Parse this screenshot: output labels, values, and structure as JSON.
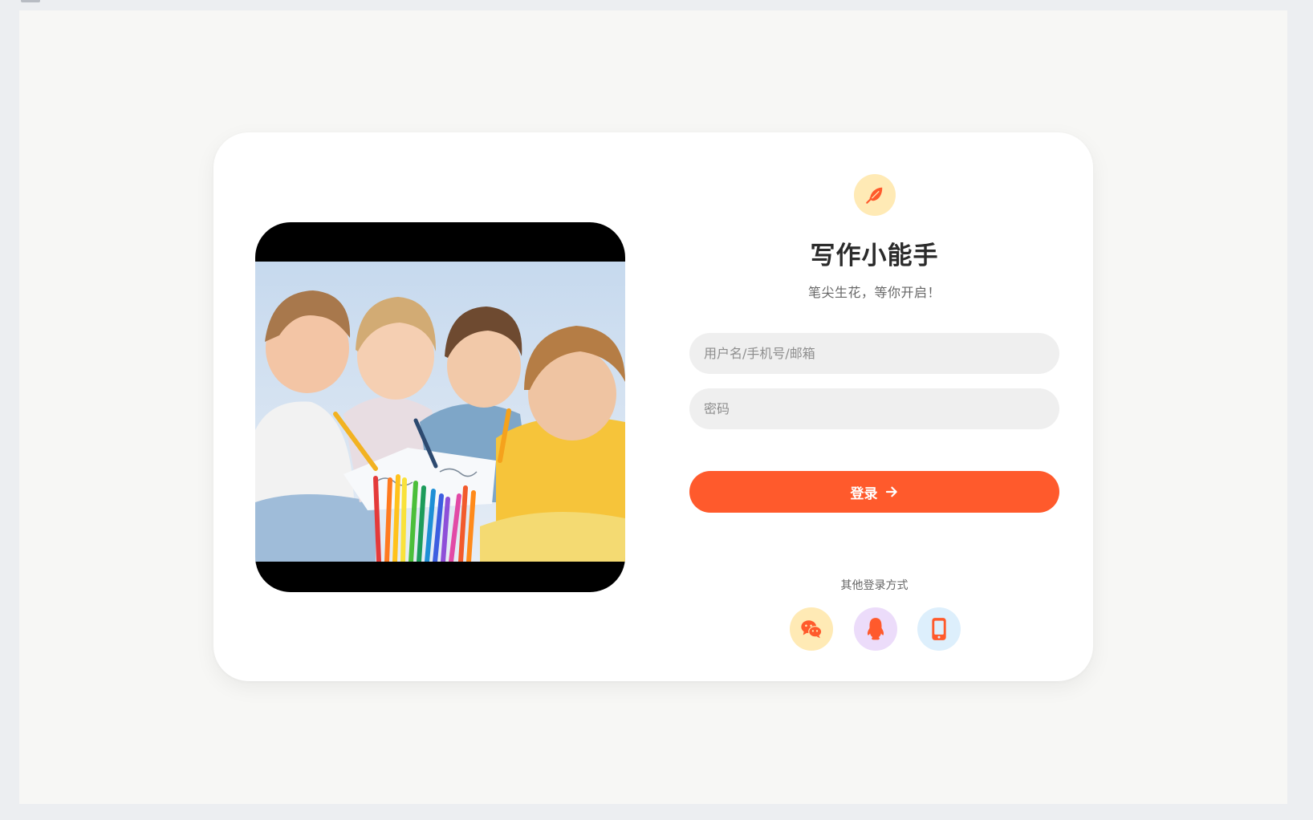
{
  "app": {
    "title": "写作小能手",
    "subtitle": "笔尖生花，等你开启！",
    "logo_icon": "feather-icon"
  },
  "form": {
    "username_placeholder": "用户名/手机号/邮箱",
    "username_value": "",
    "password_placeholder": "密码",
    "password_value": "",
    "login_label": "登录",
    "login_icon": "arrow-right-icon"
  },
  "other_login": {
    "label": "其他登录方式",
    "options": [
      {
        "icon": "wechat-icon",
        "bg": "#ffeab5"
      },
      {
        "icon": "qq-icon",
        "bg": "#ecdcfa"
      },
      {
        "icon": "mobile-phone-icon",
        "bg": "#ddeffc"
      }
    ]
  },
  "colors": {
    "accent": "#ff5a2c",
    "page_bg": "#f7f7f5",
    "card_bg": "#ffffff",
    "field_bg": "#efefef"
  }
}
